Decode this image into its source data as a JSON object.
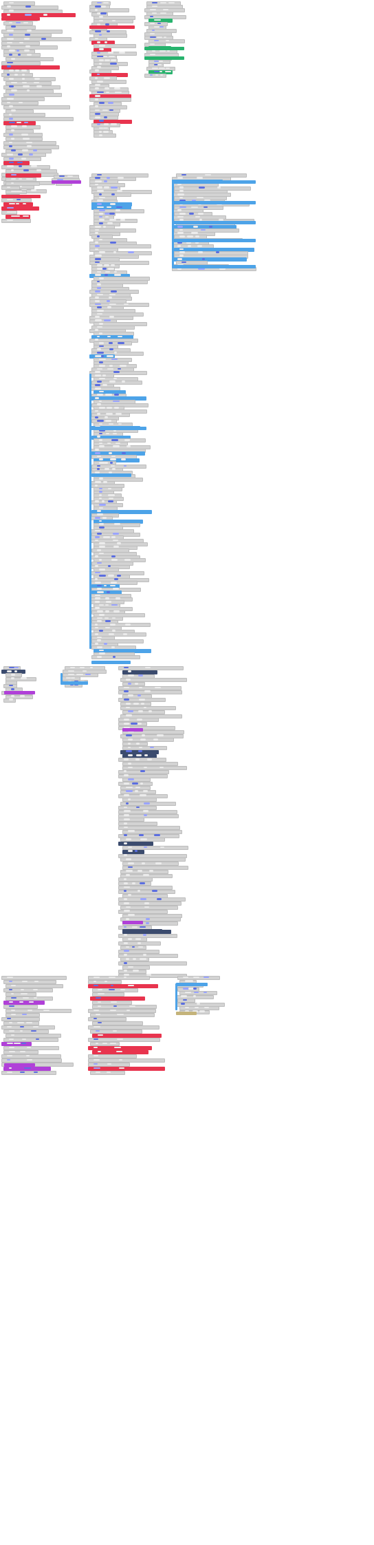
{
  "workspace": {
    "kind": "block-code-workspace",
    "colors": {
      "inactive": "#d3d3d3",
      "inactive_border": "#bdbdbd",
      "loop": "#4da3e8",
      "variable": "#e8344e",
      "math": "#5b6ee0",
      "event": "#27b36d",
      "function": "#b040d8",
      "array": "#3b4b6e",
      "text": "#c4b37a",
      "value": "#9aa4ff",
      "background": "#ffffff"
    },
    "stacks": [
      {
        "id": "stack-1",
        "rows": 48,
        "accent": "variable"
      },
      {
        "id": "stack-2",
        "rows": 38,
        "accent": "variable"
      },
      {
        "id": "stack-3",
        "rows": 22,
        "accent": "event"
      },
      {
        "id": "stack-4",
        "rows": 12,
        "accent": "variable"
      },
      {
        "id": "stack-5",
        "rows": 3,
        "accent": "function"
      },
      {
        "id": "stack-6",
        "rows": 150,
        "accent": "loop"
      },
      {
        "id": "stack-7",
        "rows": 30,
        "accent": "loop"
      },
      {
        "id": "stack-8",
        "rows": 10,
        "accent": "array"
      },
      {
        "id": "stack-9",
        "rows": 6,
        "accent": "loop"
      },
      {
        "id": "stack-10",
        "rows": 78,
        "accent": "array"
      },
      {
        "id": "stack-11",
        "rows": 24,
        "accent": "function"
      },
      {
        "id": "stack-12",
        "rows": 24,
        "accent": "variable"
      },
      {
        "id": "stack-13",
        "rows": 10,
        "accent": "loop"
      }
    ]
  }
}
